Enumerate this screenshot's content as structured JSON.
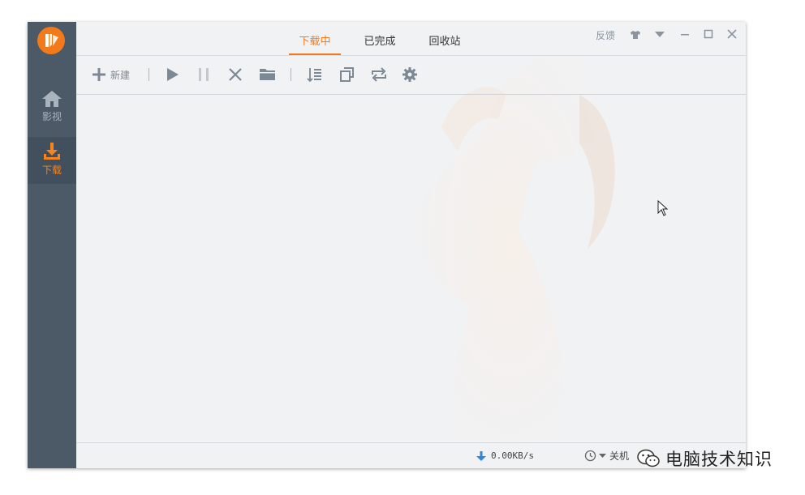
{
  "sidebar": {
    "items": [
      {
        "label": "影视",
        "icon": "home-icon"
      },
      {
        "label": "下载",
        "icon": "download-icon"
      }
    ]
  },
  "tabs": [
    {
      "label": "下载中",
      "active": true
    },
    {
      "label": "已完成",
      "active": false
    },
    {
      "label": "回收站",
      "active": false
    }
  ],
  "title_controls": {
    "feedback": "反馈",
    "icons": [
      "skin-icon",
      "menu-dropdown-icon",
      "minimize-icon",
      "maximize-icon",
      "close-icon"
    ]
  },
  "toolbar": {
    "new_label": "新建",
    "icons": [
      "plus-icon",
      "play-icon",
      "pause-icon",
      "delete-icon",
      "folder-icon",
      "sort-icon",
      "copy-icon",
      "refresh-icon",
      "settings-icon"
    ]
  },
  "status": {
    "speed": "0.00KB/s",
    "schedule_label": "关机"
  },
  "watermark": {
    "text": "电脑技术知识"
  },
  "colors": {
    "accent": "#f27a1a",
    "sidebar": "#4c5967",
    "sidebar_active": "#424f5c"
  }
}
